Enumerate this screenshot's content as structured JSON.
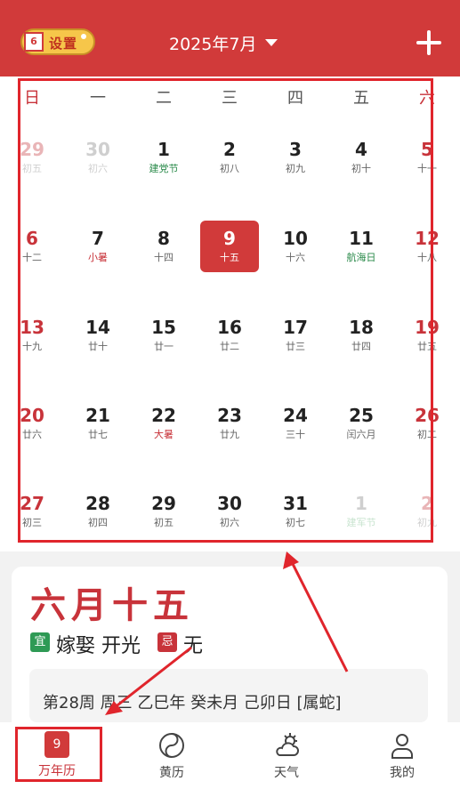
{
  "header": {
    "settings_icon_day": "6",
    "settings_label": "设置",
    "month_title": "2025年7月",
    "add_icon": "plus-icon"
  },
  "weekdays": [
    "日",
    "一",
    "二",
    "三",
    "四",
    "五",
    "六"
  ],
  "weeks": [
    [
      {
        "d": "29",
        "s": "初五",
        "faded": true
      },
      {
        "d": "30",
        "s": "初六",
        "faded": true
      },
      {
        "d": "1",
        "s": "建党节",
        "tag": "green"
      },
      {
        "d": "2",
        "s": "初八"
      },
      {
        "d": "3",
        "s": "初九"
      },
      {
        "d": "4",
        "s": "初十"
      },
      {
        "d": "5",
        "s": "十一"
      }
    ],
    [
      {
        "d": "6",
        "s": "十二"
      },
      {
        "d": "7",
        "s": "小暑",
        "tag": "red"
      },
      {
        "d": "8",
        "s": "十四"
      },
      {
        "d": "9",
        "s": "十五",
        "today": true
      },
      {
        "d": "10",
        "s": "十六"
      },
      {
        "d": "11",
        "s": "航海日",
        "tag": "green"
      },
      {
        "d": "12",
        "s": "十八"
      }
    ],
    [
      {
        "d": "13",
        "s": "十九"
      },
      {
        "d": "14",
        "s": "廿十"
      },
      {
        "d": "15",
        "s": "廿一"
      },
      {
        "d": "16",
        "s": "廿二"
      },
      {
        "d": "17",
        "s": "廿三"
      },
      {
        "d": "18",
        "s": "廿四"
      },
      {
        "d": "19",
        "s": "廿五"
      }
    ],
    [
      {
        "d": "20",
        "s": "廿六"
      },
      {
        "d": "21",
        "s": "廿七"
      },
      {
        "d": "22",
        "s": "大暑",
        "tag": "red"
      },
      {
        "d": "23",
        "s": "廿九"
      },
      {
        "d": "24",
        "s": "三十"
      },
      {
        "d": "25",
        "s": "闰六月"
      },
      {
        "d": "26",
        "s": "初二"
      }
    ],
    [
      {
        "d": "27",
        "s": "初三"
      },
      {
        "d": "28",
        "s": "初四"
      },
      {
        "d": "29",
        "s": "初五"
      },
      {
        "d": "30",
        "s": "初六"
      },
      {
        "d": "31",
        "s": "初七"
      },
      {
        "d": "1",
        "s": "建军节",
        "faded": true,
        "tag": "green"
      },
      {
        "d": "2",
        "s": "初九",
        "faded": true
      }
    ]
  ],
  "detail": {
    "lunar_date": "六月十五",
    "yi_label": "宜",
    "yi_text": "嫁娶 开光",
    "ji_label": "忌",
    "ji_text": "无",
    "ganzhi": "第28周 周三 乙巳年 癸未月 己卯日 [属蛇]"
  },
  "tabs": [
    {
      "label": "万年历",
      "icon": "calendar-icon",
      "icon_text": "9",
      "active": true
    },
    {
      "label": "黄历",
      "icon": "yin-yang-icon"
    },
    {
      "label": "天气",
      "icon": "weather-cloud-sun-icon"
    },
    {
      "label": "我的",
      "icon": "person-icon"
    }
  ],
  "colors": {
    "brand_red": "#d13a3a",
    "green": "#2a8a4a",
    "annotation_red": "#e0252c"
  }
}
